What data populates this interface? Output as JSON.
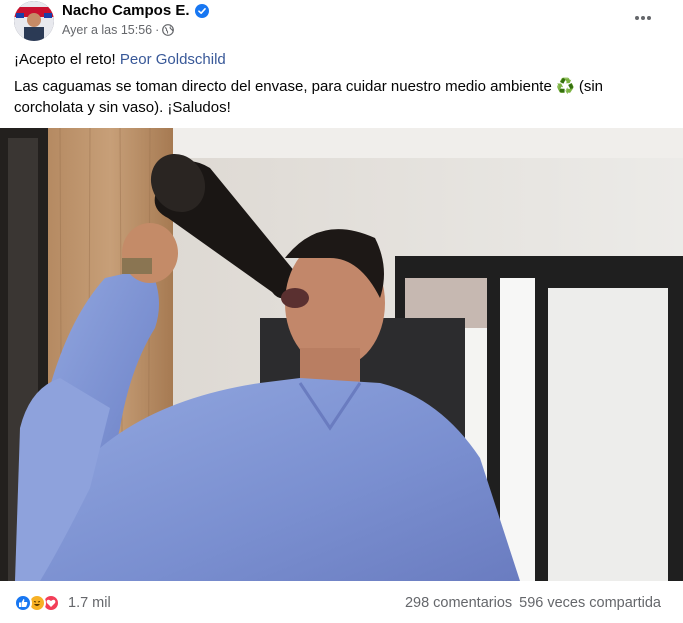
{
  "post": {
    "author": "Nacho Campos E.",
    "timestamp": "Ayer a las 15:56",
    "separator": "·",
    "privacy_icon": "globe-icon",
    "verified_icon": "verified-badge-icon",
    "more_icon": "more-horizontal-icon",
    "text_line1_prefix": "¡Acepto el reto!",
    "mention": "Peor Goldschild",
    "text_body_before_emoji": "Las caguamas se toman directo del envase, para cuidar nuestro medio ambiente",
    "emoji": "♻️",
    "text_body_after_emoji": "(sin corcholata y sin vaso). ¡Saludos!"
  },
  "footer": {
    "reaction_icons": [
      "like-icon",
      "haha-icon",
      "love-icon"
    ],
    "reaction_count": "1.7 mil",
    "comments": "298 comentarios",
    "shares": "596 veces compartida"
  },
  "colors": {
    "link": "#385898",
    "secondary_text": "#65676b",
    "like_blue": "#1877f2",
    "haha_yellow": "#f7b125",
    "love_red": "#f33e58"
  }
}
